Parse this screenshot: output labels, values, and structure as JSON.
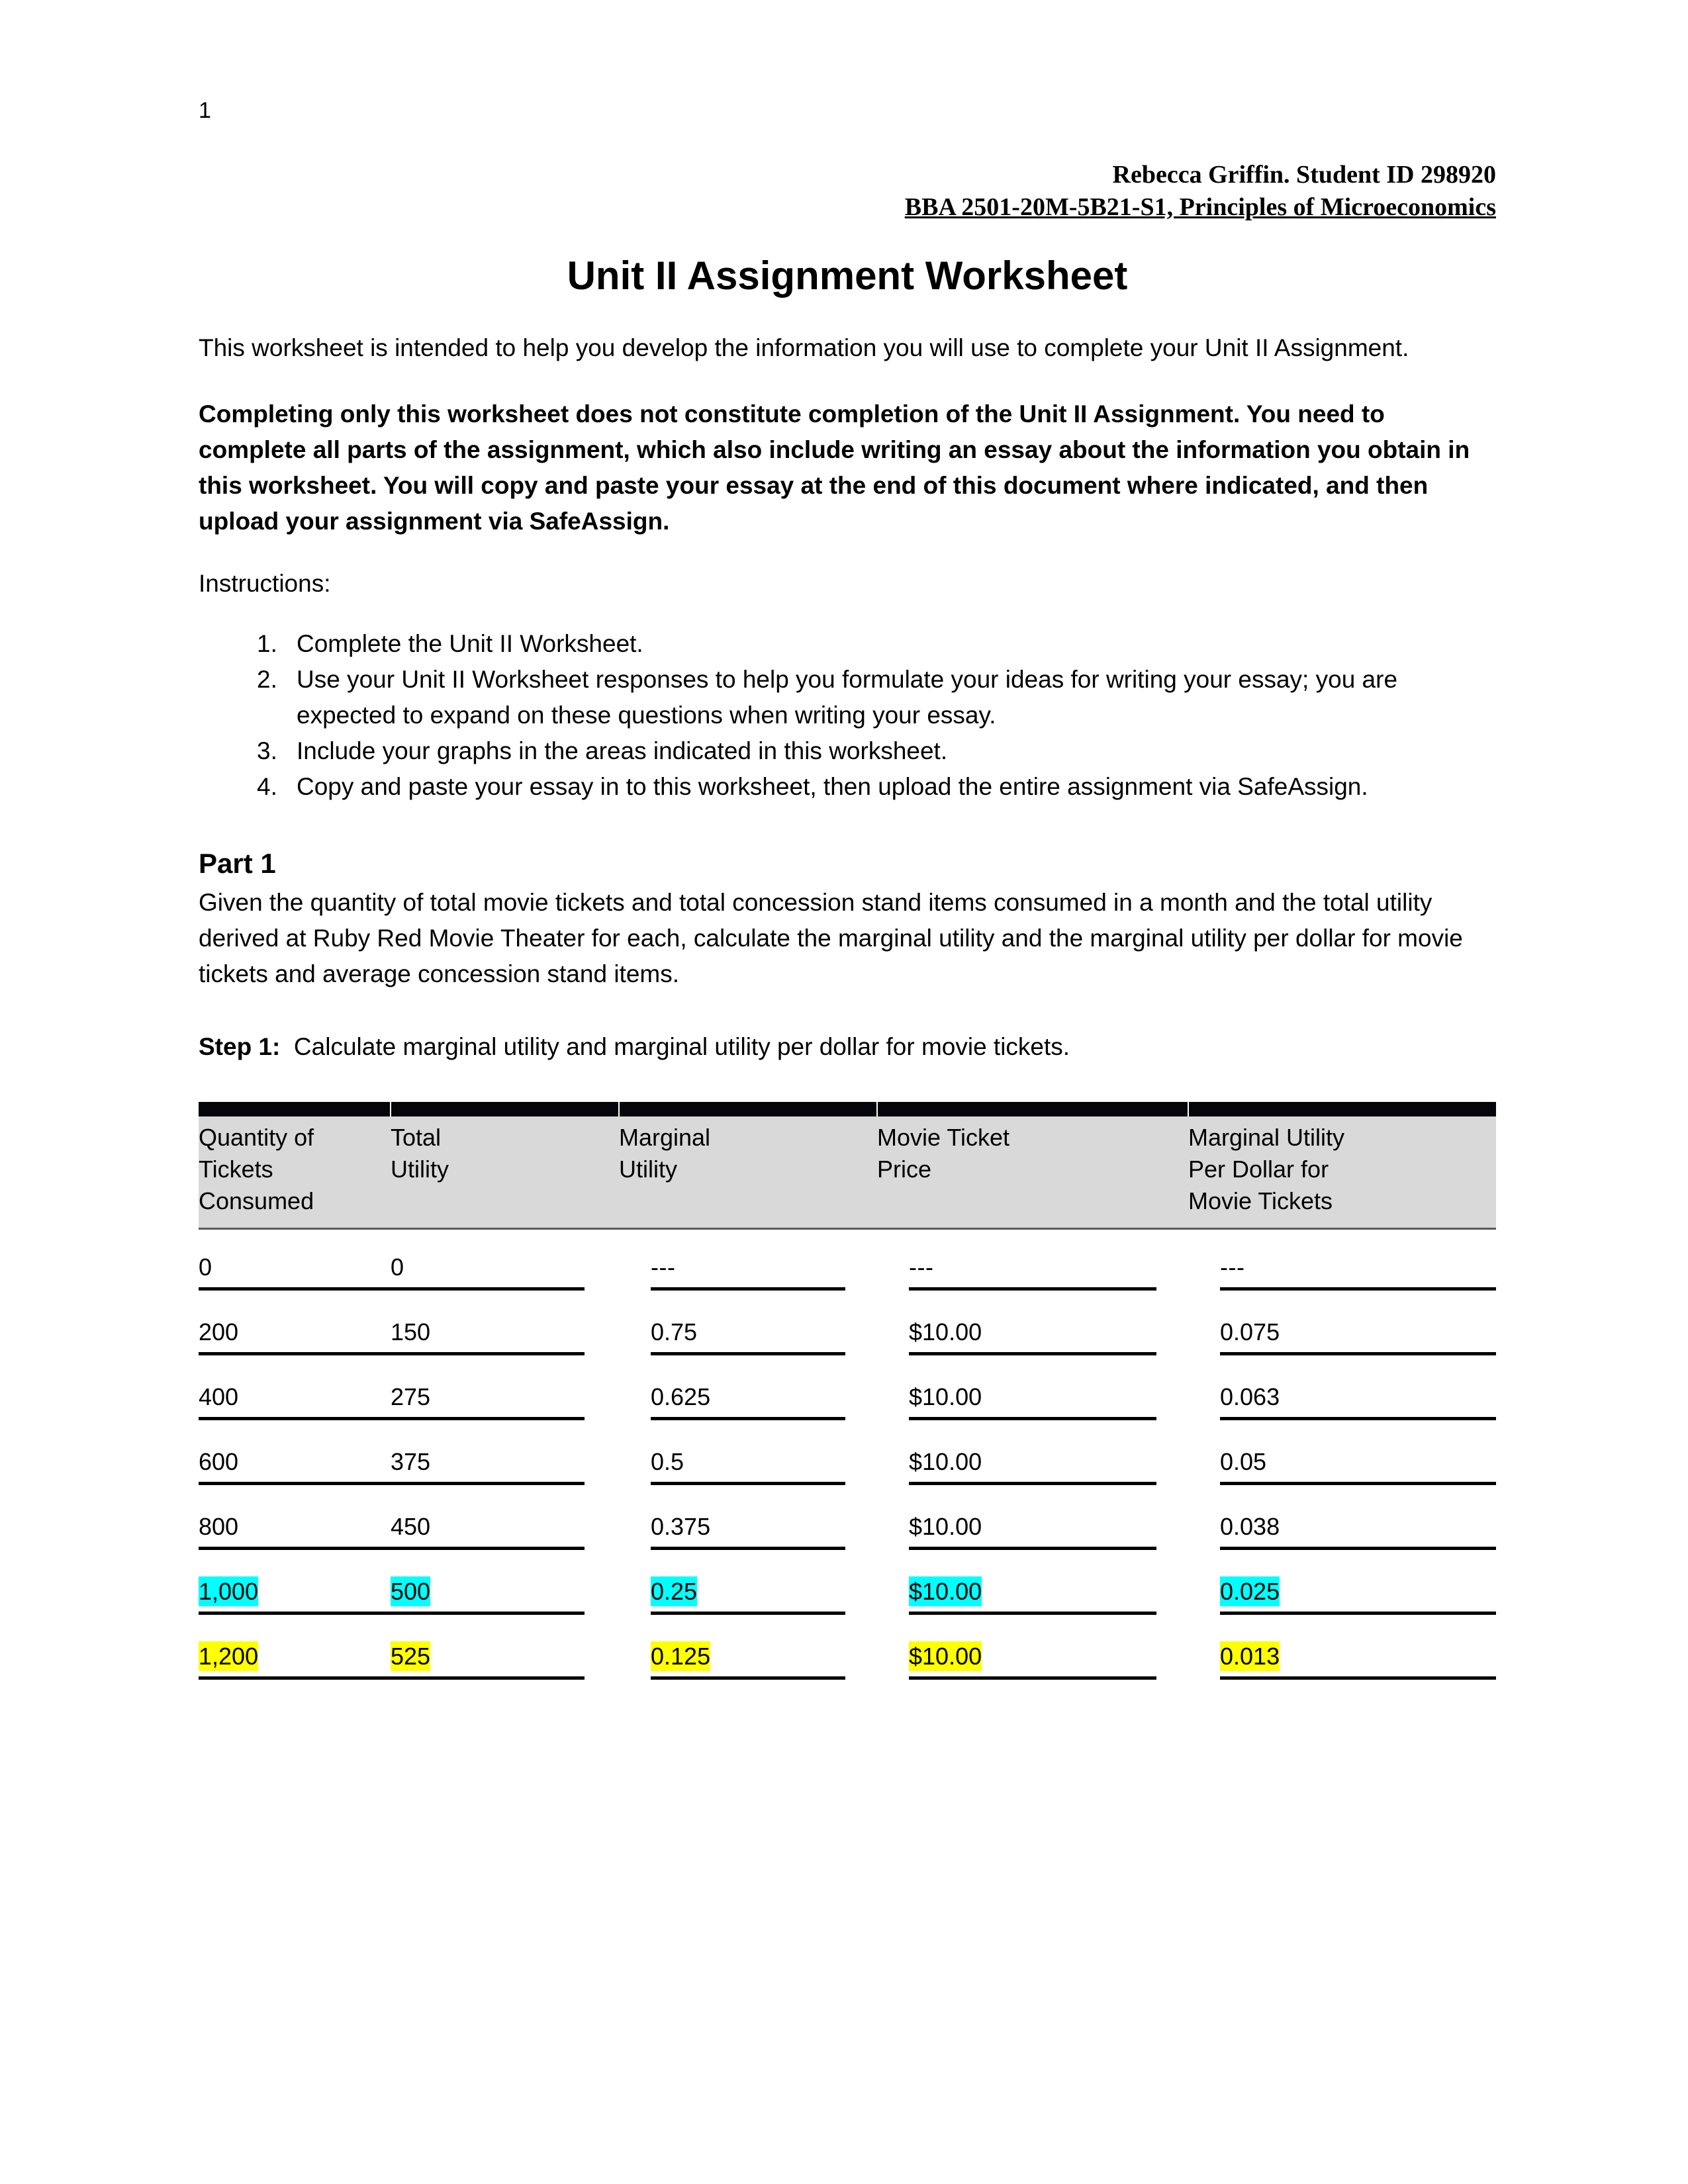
{
  "page": {
    "number": "1"
  },
  "header": {
    "line1": "Rebecca Griffin. Student ID 298920",
    "line2": "BBA 2501-20M-5B21-S1, Principles of Microeconomics"
  },
  "title": "Unit II Assignment Worksheet",
  "intro": {
    "paragraph1": "This worksheet is intended to help you develop the information you will use to complete your Unit II Assignment.",
    "paragraph2": "Completing only this worksheet does not constitute completion of the Unit II Assignment. You need to complete all parts of the assignment, which also include writing an essay about the information you obtain in this worksheet. You will copy and paste your essay at the end of this document where indicated, and then upload your assignment via SafeAssign."
  },
  "instructions": {
    "label": "Instructions:",
    "items": [
      {
        "num": "1.",
        "text": "Complete the Unit II Worksheet."
      },
      {
        "num": "2.",
        "text": "Use your Unit II Worksheet responses to help you formulate your ideas for writing your essay; you are expected to expand on these questions when writing your essay."
      },
      {
        "num": "3.",
        "text": "Include your graphs in the areas indicated in this worksheet."
      },
      {
        "num": "4.",
        "text": "Copy and paste your essay in to this worksheet, then upload the entire assignment via SafeAssign."
      }
    ]
  },
  "part1": {
    "heading": "Part 1",
    "body": "Given the quantity of total movie tickets and total concession stand items consumed in a month and the total utility derived at Ruby Red Movie Theater for each, calculate the marginal utility and the marginal utility per dollar for movie tickets and average concession stand items.",
    "step_label": "Step 1:",
    "step_text": "Calculate marginal utility and marginal utility per dollar for movie tickets."
  },
  "table": {
    "headers": [
      {
        "l1": "Quantity of",
        "l2": "Tickets",
        "l3": "Consumed"
      },
      {
        "l1": "Total",
        "l2": "Utility",
        "l3": ""
      },
      {
        "l1": "Marginal",
        "l2": "Utility",
        "l3": ""
      },
      {
        "l1": "Movie Ticket",
        "l2": "Price",
        "l3": ""
      },
      {
        "l1": "Marginal Utility",
        "l2": "Per Dollar for",
        "l3": "Movie Tickets"
      }
    ],
    "rows": [
      {
        "highlight": "none",
        "cells": [
          "0",
          "0",
          "---",
          "---",
          "---"
        ]
      },
      {
        "highlight": "none",
        "cells": [
          "200",
          "150",
          "0.75",
          "$10.00",
          "0.075"
        ]
      },
      {
        "highlight": "none",
        "cells": [
          "400",
          "275",
          "0.625",
          "$10.00",
          "0.063"
        ]
      },
      {
        "highlight": "none",
        "cells": [
          "600",
          "375",
          "0.5",
          "$10.00",
          "0.05"
        ]
      },
      {
        "highlight": "none",
        "cells": [
          "800",
          "450",
          "0.375",
          "$10.00",
          "0.038"
        ]
      },
      {
        "highlight": "cyan",
        "cells": [
          "1,000",
          "500",
          "0.25",
          "$10.00",
          "0.025"
        ]
      },
      {
        "highlight": "yellow",
        "cells": [
          "1,200",
          "525",
          "0.125",
          "$10.00",
          "0.013"
        ]
      }
    ],
    "colors": {
      "header_band": "#d9d9d9",
      "top_bar": "#05050c",
      "highlight_cyan": "#00ffff",
      "highlight_yellow": "#ffff00"
    }
  }
}
